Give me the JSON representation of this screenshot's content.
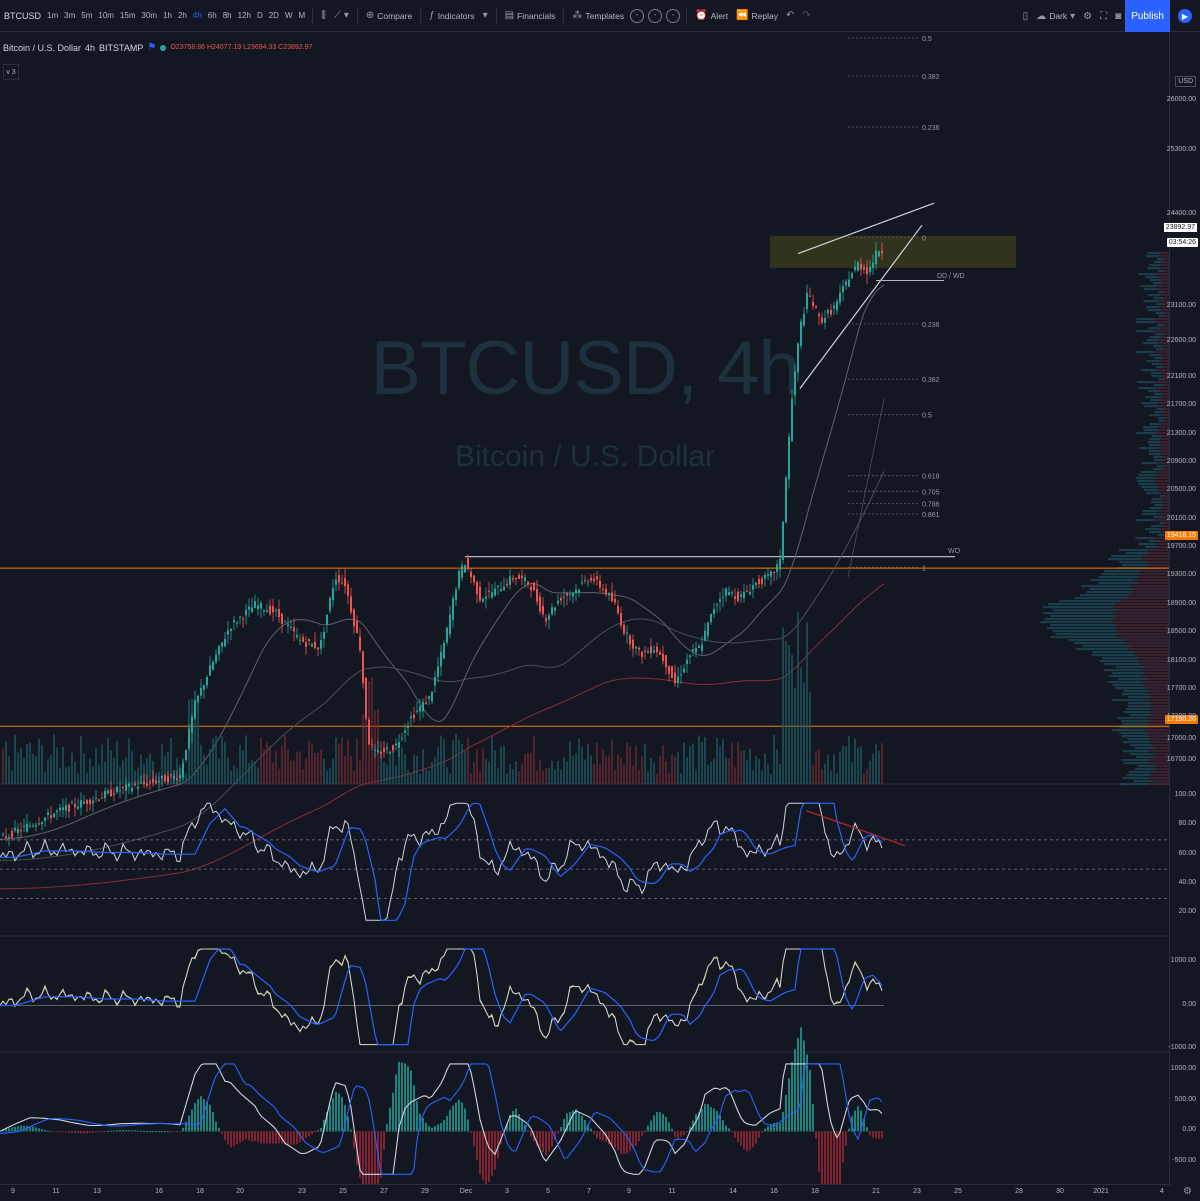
{
  "toolbar": {
    "symbol": "BTCUSD",
    "timeframes": [
      "1m",
      "3m",
      "5m",
      "10m",
      "15m",
      "30m",
      "1h",
      "2h",
      "4h",
      "6h",
      "8h",
      "12h",
      "D",
      "2D",
      "W",
      "M"
    ],
    "active_timeframe": "4h",
    "compare": "Compare",
    "indicators": "Indicators",
    "financials": "Financials",
    "templates": "Templates",
    "alert": "Alert",
    "replay": "Replay",
    "theme": "Dark",
    "publish": "Publish"
  },
  "legend": {
    "name": "Bitcoin / U.S. Dollar",
    "interval": "4h",
    "exchange": "BITSTAMP",
    "ohlc": "O23758.86  H24077.19  L23694.33  C23892.97",
    "collapse_count": "3"
  },
  "watermark": {
    "ticker": "BTCUSD, 4h",
    "description": "Bitcoin / U.S. Dollar"
  },
  "price_axis": {
    "currency": "USD",
    "current_price": "23892.97",
    "countdown": "03:54:26",
    "level_high": "19418.15",
    "level_low": "17190.26"
  },
  "chart_data": [
    {
      "type": "candlestick",
      "price_ticks": [
        "26000.00",
        "25300.00",
        "24400.00",
        "23100.00",
        "22600.00",
        "22100.00",
        "21700.00",
        "21300.00",
        "20900.00",
        "20500.00",
        "20100.00",
        "19700.00",
        "19300.00",
        "18900.00",
        "18500.00",
        "18100.00",
        "17700.00",
        "17300.00",
        "17000.00",
        "16700.00"
      ],
      "horizontal_levels": [
        19418.15,
        17190.26
      ],
      "fib_levels": [
        "0.5",
        "0.382",
        "0.236",
        "0",
        "0.236",
        "0.382",
        "0.5",
        "0.618",
        "0.705",
        "0.786",
        "0.861",
        "1"
      ],
      "annotations": [
        "DD / WD",
        "WO"
      ],
      "highlight_zone": [
        23650,
        24100
      ]
    },
    {
      "type": "line",
      "name": "RSI",
      "y_ticks": [
        "100.00",
        "80.00",
        "60.00",
        "40.00",
        "20.00"
      ],
      "ylim": [
        0,
        100
      ]
    },
    {
      "type": "line",
      "name": "Oscillator",
      "y_ticks": [
        "1000.00",
        "0.00",
        "-1000.00"
      ]
    },
    {
      "type": "line",
      "name": "MACD",
      "y_ticks": [
        "1000.00",
        "500.00",
        "0.00",
        "-500.00"
      ]
    }
  ],
  "time_axis": [
    {
      "label": "9"
    },
    {
      "label": "11"
    },
    {
      "label": "13"
    },
    {
      "label": "16"
    },
    {
      "label": "18"
    },
    {
      "label": "20"
    },
    {
      "label": "23"
    },
    {
      "label": "25"
    },
    {
      "label": "27"
    },
    {
      "label": "29"
    },
    {
      "label": "Dec"
    },
    {
      "label": "3"
    },
    {
      "label": "5"
    },
    {
      "label": "7"
    },
    {
      "label": "9"
    },
    {
      "label": "11"
    },
    {
      "label": "14"
    },
    {
      "label": "16"
    },
    {
      "label": "18"
    },
    {
      "label": "21"
    },
    {
      "label": "23"
    },
    {
      "label": "25"
    },
    {
      "label": "28"
    },
    {
      "label": "30"
    },
    {
      "label": "2021"
    },
    {
      "label": "4"
    }
  ],
  "colors": {
    "background": "#131722",
    "up": "#26a69a",
    "down": "#ef5350",
    "accent": "#2962ff",
    "level": "#f57c00"
  }
}
